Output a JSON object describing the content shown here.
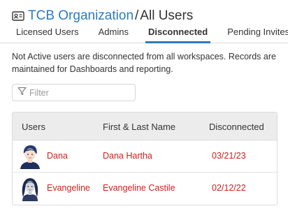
{
  "header": {
    "org_name": "TCB Organization",
    "separator": "/",
    "page_title": "All Users"
  },
  "tabs": [
    {
      "label": "Licensed Users",
      "active": false
    },
    {
      "label": "Admins",
      "active": false
    },
    {
      "label": "Disconnected",
      "active": true
    },
    {
      "label": "Pending Invites",
      "active": false
    }
  ],
  "info_text": "Not Active users are disconnected from all workspaces. Records are maintained for Dashboards and reporting.",
  "filter": {
    "placeholder": "Filter",
    "value": ""
  },
  "table": {
    "columns": [
      "Users",
      "First & Last Name",
      "Disconnected"
    ],
    "rows": [
      {
        "user": "Dana",
        "full_name": "Dana Hartha",
        "disconnected": "03/21/23",
        "avatar": "female-avatar-short-hair"
      },
      {
        "user": "Evangeline",
        "full_name": "Evangeline Castile",
        "disconnected": "02/12/22",
        "avatar": "female-avatar-long-hair"
      }
    ]
  },
  "colors": {
    "accent": "#2a7bc0",
    "row_text": "#d0201b",
    "header_bg": "#ececec"
  }
}
